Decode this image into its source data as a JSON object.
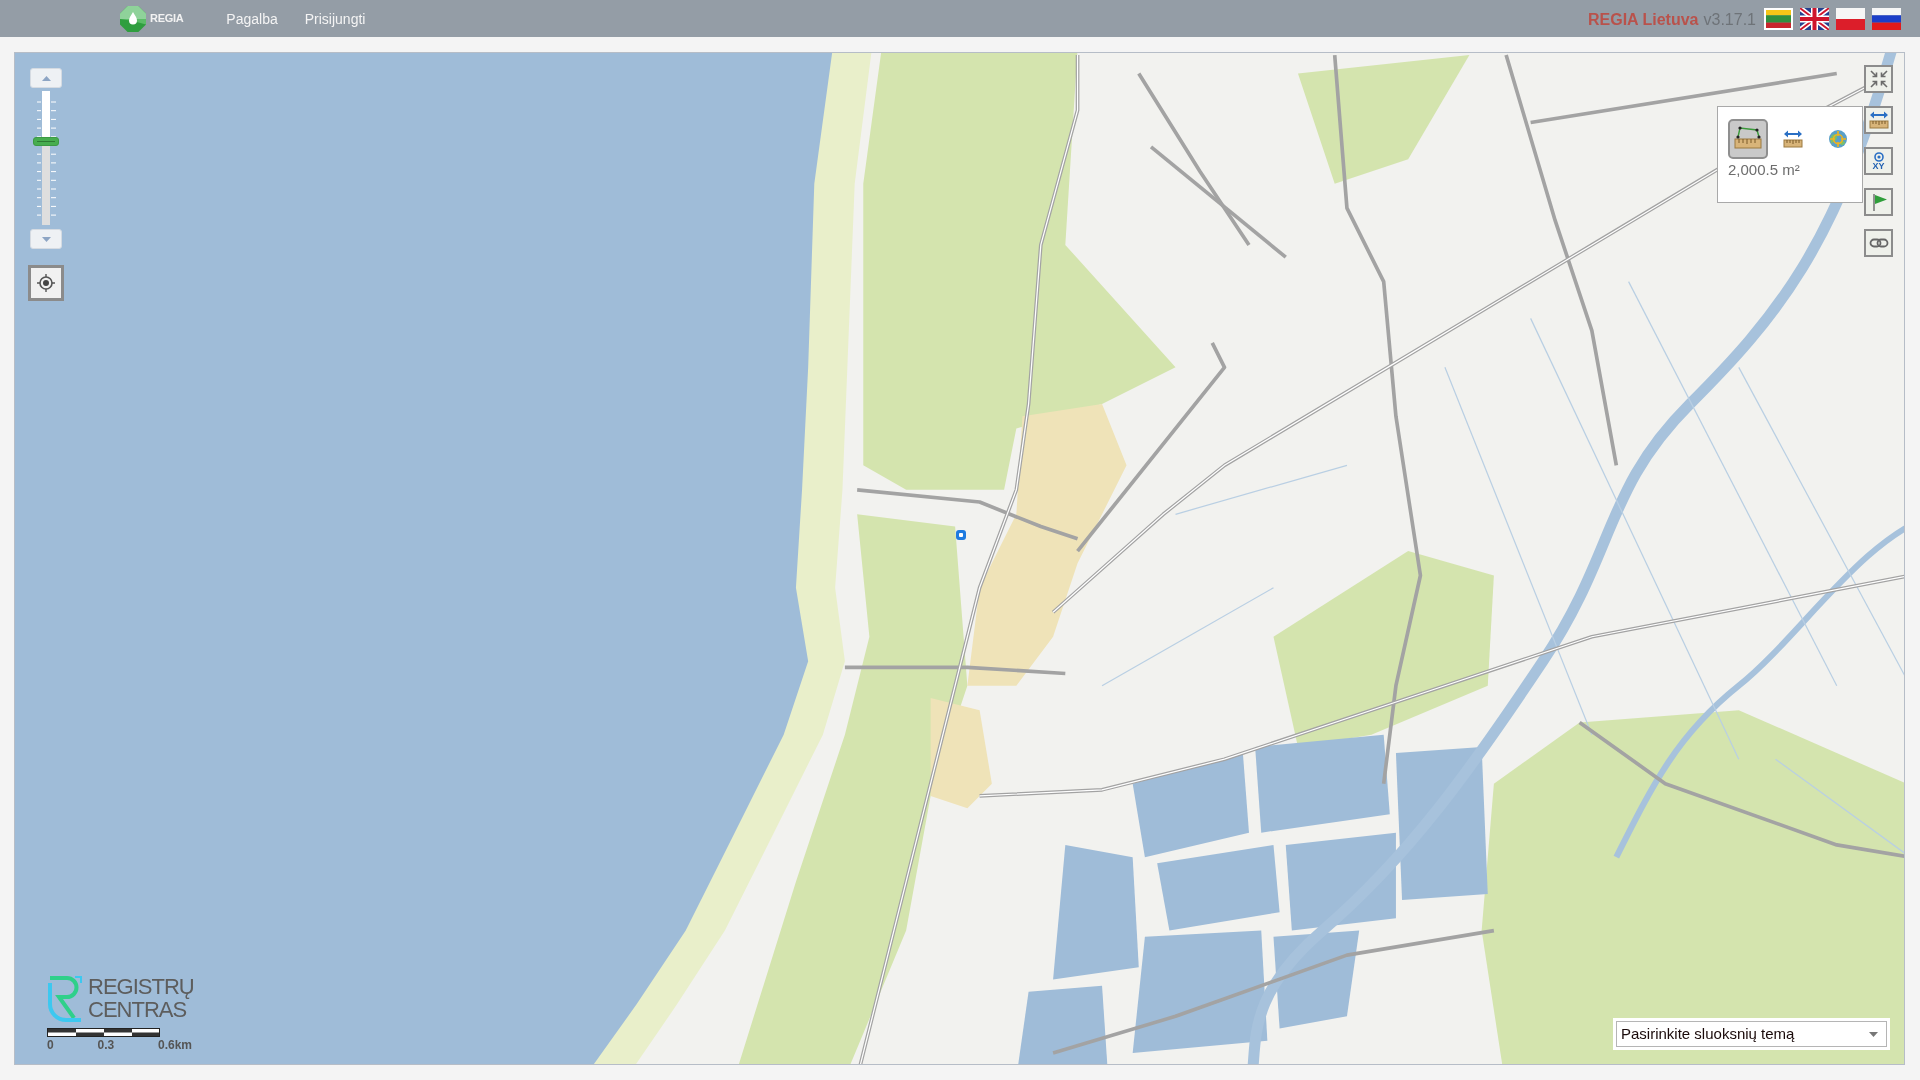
{
  "header": {
    "logo_text": "REGIA",
    "nav": [
      {
        "label": "Pagalba"
      },
      {
        "label": "Prisijungti"
      }
    ],
    "app_name": "REGIA Lietuva",
    "version": "v3.17.1",
    "languages": [
      {
        "kind": "lithuanian",
        "selected": true
      },
      {
        "kind": "english",
        "selected": false
      },
      {
        "kind": "polish",
        "selected": false
      },
      {
        "kind": "russian",
        "selected": false
      }
    ]
  },
  "map": {
    "zoom_slider": {
      "level": 0.62
    },
    "tool_buttons": [
      {
        "kind": "fullscreen"
      },
      {
        "kind": "measure"
      },
      {
        "kind": "coordinates",
        "label": "XY"
      },
      {
        "kind": "marker"
      },
      {
        "kind": "link"
      }
    ],
    "measure_panel": {
      "tools": [
        {
          "kind": "area",
          "selected": true
        },
        {
          "kind": "distance",
          "selected": false
        },
        {
          "kind": "position",
          "selected": false
        }
      ],
      "result": "2,000.5 m²"
    },
    "logo_text": [
      "REGISTRŲ",
      "CENTRAS"
    ],
    "scale_labels": [
      "0",
      "0.3",
      "0.6km"
    ],
    "layer_theme_select": {
      "value": "Pasirinkite sluoksnių temą"
    }
  }
}
